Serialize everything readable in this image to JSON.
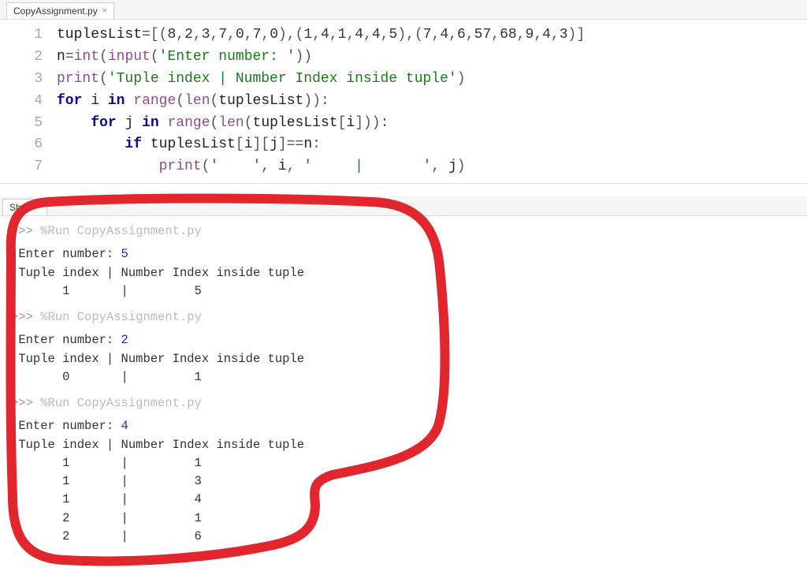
{
  "editor_tab": {
    "filename": "CopyAssignment.py"
  },
  "code": {
    "lines": [
      {
        "num": "1",
        "tokens": [
          {
            "t": "id",
            "v": "tuplesList"
          },
          {
            "t": "op",
            "v": "="
          },
          {
            "t": "punc",
            "v": "[("
          },
          {
            "t": "num",
            "v": "8"
          },
          {
            "t": "punc",
            "v": ","
          },
          {
            "t": "num",
            "v": "2"
          },
          {
            "t": "punc",
            "v": ","
          },
          {
            "t": "num",
            "v": "3"
          },
          {
            "t": "punc",
            "v": ","
          },
          {
            "t": "num",
            "v": "7"
          },
          {
            "t": "punc",
            "v": ","
          },
          {
            "t": "num",
            "v": "0"
          },
          {
            "t": "punc",
            "v": ","
          },
          {
            "t": "num",
            "v": "7"
          },
          {
            "t": "punc",
            "v": ","
          },
          {
            "t": "num",
            "v": "0"
          },
          {
            "t": "punc",
            "v": "),("
          },
          {
            "t": "num",
            "v": "1"
          },
          {
            "t": "punc",
            "v": ","
          },
          {
            "t": "num",
            "v": "4"
          },
          {
            "t": "punc",
            "v": ","
          },
          {
            "t": "num",
            "v": "1"
          },
          {
            "t": "punc",
            "v": ","
          },
          {
            "t": "num",
            "v": "4"
          },
          {
            "t": "punc",
            "v": ","
          },
          {
            "t": "num",
            "v": "4"
          },
          {
            "t": "punc",
            "v": ","
          },
          {
            "t": "num",
            "v": "5"
          },
          {
            "t": "punc",
            "v": "),("
          },
          {
            "t": "num",
            "v": "7"
          },
          {
            "t": "punc",
            "v": ","
          },
          {
            "t": "num",
            "v": "4"
          },
          {
            "t": "punc",
            "v": ","
          },
          {
            "t": "num",
            "v": "6"
          },
          {
            "t": "punc",
            "v": ","
          },
          {
            "t": "num",
            "v": "57"
          },
          {
            "t": "punc",
            "v": ","
          },
          {
            "t": "num",
            "v": "68"
          },
          {
            "t": "punc",
            "v": ","
          },
          {
            "t": "num",
            "v": "9"
          },
          {
            "t": "punc",
            "v": ","
          },
          {
            "t": "num",
            "v": "4"
          },
          {
            "t": "punc",
            "v": ","
          },
          {
            "t": "num",
            "v": "3"
          },
          {
            "t": "punc",
            "v": ")]"
          }
        ]
      },
      {
        "num": "2",
        "tokens": [
          {
            "t": "id",
            "v": "n"
          },
          {
            "t": "op",
            "v": "="
          },
          {
            "t": "builtin",
            "v": "int"
          },
          {
            "t": "punc",
            "v": "("
          },
          {
            "t": "builtin",
            "v": "input"
          },
          {
            "t": "punc",
            "v": "("
          },
          {
            "t": "str",
            "v": "'Enter number: '"
          },
          {
            "t": "punc",
            "v": "))"
          }
        ]
      },
      {
        "num": "3",
        "tokens": [
          {
            "t": "builtin",
            "v": "print"
          },
          {
            "t": "punc",
            "v": "("
          },
          {
            "t": "str",
            "v": "'Tuple index | Number Index inside tuple'"
          },
          {
            "t": "punc",
            "v": ")"
          }
        ]
      },
      {
        "num": "4",
        "tokens": [
          {
            "t": "kw",
            "v": "for"
          },
          {
            "t": "plain",
            "v": " "
          },
          {
            "t": "id",
            "v": "i"
          },
          {
            "t": "plain",
            "v": " "
          },
          {
            "t": "kw",
            "v": "in"
          },
          {
            "t": "plain",
            "v": " "
          },
          {
            "t": "builtin",
            "v": "range"
          },
          {
            "t": "punc",
            "v": "("
          },
          {
            "t": "builtin",
            "v": "len"
          },
          {
            "t": "punc",
            "v": "("
          },
          {
            "t": "id",
            "v": "tuplesList"
          },
          {
            "t": "punc",
            "v": ")):"
          }
        ]
      },
      {
        "num": "5",
        "tokens": [
          {
            "t": "plain",
            "v": "    "
          },
          {
            "t": "kw",
            "v": "for"
          },
          {
            "t": "plain",
            "v": " "
          },
          {
            "t": "id",
            "v": "j"
          },
          {
            "t": "plain",
            "v": " "
          },
          {
            "t": "kw",
            "v": "in"
          },
          {
            "t": "plain",
            "v": " "
          },
          {
            "t": "builtin",
            "v": "range"
          },
          {
            "t": "punc",
            "v": "("
          },
          {
            "t": "builtin",
            "v": "len"
          },
          {
            "t": "punc",
            "v": "("
          },
          {
            "t": "id",
            "v": "tuplesList"
          },
          {
            "t": "punc",
            "v": "["
          },
          {
            "t": "id",
            "v": "i"
          },
          {
            "t": "punc",
            "v": "])):"
          }
        ]
      },
      {
        "num": "6",
        "tokens": [
          {
            "t": "plain",
            "v": "        "
          },
          {
            "t": "kw",
            "v": "if"
          },
          {
            "t": "plain",
            "v": " "
          },
          {
            "t": "id",
            "v": "tuplesList"
          },
          {
            "t": "punc",
            "v": "["
          },
          {
            "t": "id",
            "v": "i"
          },
          {
            "t": "punc",
            "v": "]["
          },
          {
            "t": "id",
            "v": "j"
          },
          {
            "t": "punc",
            "v": "]"
          },
          {
            "t": "op",
            "v": "=="
          },
          {
            "t": "id",
            "v": "n"
          },
          {
            "t": "punc",
            "v": ":"
          }
        ]
      },
      {
        "num": "7",
        "tokens": [
          {
            "t": "plain",
            "v": "            "
          },
          {
            "t": "builtin",
            "v": "print"
          },
          {
            "t": "punc",
            "v": "("
          },
          {
            "t": "str",
            "v": "'    '"
          },
          {
            "t": "punc",
            "v": ", "
          },
          {
            "t": "id",
            "v": "i"
          },
          {
            "t": "punc",
            "v": ", "
          },
          {
            "t": "str",
            "v": "'     |       '"
          },
          {
            "t": "punc",
            "v": ", "
          },
          {
            "t": "id",
            "v": "j"
          },
          {
            "t": "punc",
            "v": ")"
          }
        ]
      }
    ]
  },
  "shell_tab": {
    "label": "Shell"
  },
  "shell": {
    "runs": [
      {
        "prompt": ">>>",
        "command": "%Run CopyAssignment.py",
        "output": [
          [
            {
              "t": "text",
              "v": "Enter number: "
            },
            {
              "t": "num",
              "v": "5"
            }
          ],
          [
            {
              "t": "text",
              "v": "Tuple index | Number Index inside tuple"
            }
          ],
          [
            {
              "t": "text",
              "v": "      1       |         5"
            }
          ]
        ]
      },
      {
        "prompt": ">>>",
        "command": "%Run CopyAssignment.py",
        "output": [
          [
            {
              "t": "text",
              "v": "Enter number: "
            },
            {
              "t": "num",
              "v": "2"
            }
          ],
          [
            {
              "t": "text",
              "v": "Tuple index | Number Index inside tuple"
            }
          ],
          [
            {
              "t": "text",
              "v": "      0       |         1"
            }
          ]
        ]
      },
      {
        "prompt": ">>>",
        "command": "%Run CopyAssignment.py",
        "output": [
          [
            {
              "t": "text",
              "v": "Enter number: "
            },
            {
              "t": "num",
              "v": "4"
            }
          ],
          [
            {
              "t": "text",
              "v": "Tuple index | Number Index inside tuple"
            }
          ],
          [
            {
              "t": "text",
              "v": "      1       |         1"
            }
          ],
          [
            {
              "t": "text",
              "v": "      1       |         3"
            }
          ],
          [
            {
              "t": "text",
              "v": "      1       |         4"
            }
          ],
          [
            {
              "t": "text",
              "v": "      2       |         1"
            }
          ],
          [
            {
              "t": "text",
              "v": "      2       |         6"
            }
          ]
        ]
      }
    ]
  }
}
